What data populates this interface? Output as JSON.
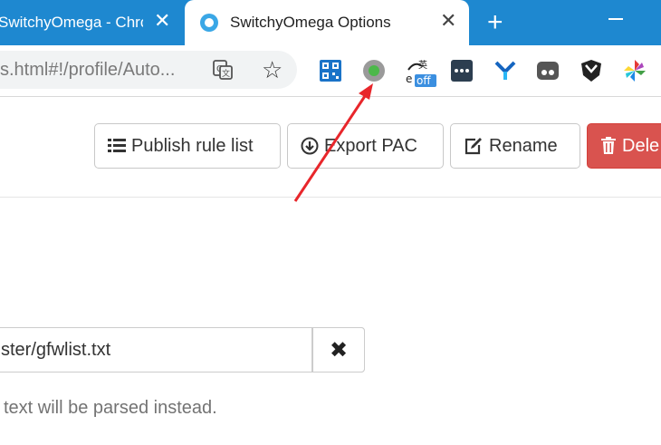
{
  "tabs": [
    {
      "title": "SwitchyOmega - Chrome",
      "active": false
    },
    {
      "title": "SwitchyOmega Options",
      "active": true
    }
  ],
  "new_tab_label": "+",
  "omnibox": {
    "url": "s.html#!/profile/Auto..."
  },
  "extensions": [
    "qr-code-icon",
    "proxy-status-icon",
    "translate-off-icon",
    "dots-icon",
    "y-icon",
    "ghost-icon",
    "shield-icon",
    "pinwheel-icon"
  ],
  "extension_badge": "off",
  "actions": {
    "publish": "Publish rule list",
    "export": "Export PAC",
    "rename": "Rename",
    "delete": "Dele"
  },
  "rule_list_url": "ster/gfwlist.txt",
  "clear_symbol": "✖",
  "help_text": "text will be parsed instead.",
  "colors": {
    "tabstrip": "#1e88d0",
    "delete": "#d9534f",
    "annotation": "#e8262b"
  }
}
